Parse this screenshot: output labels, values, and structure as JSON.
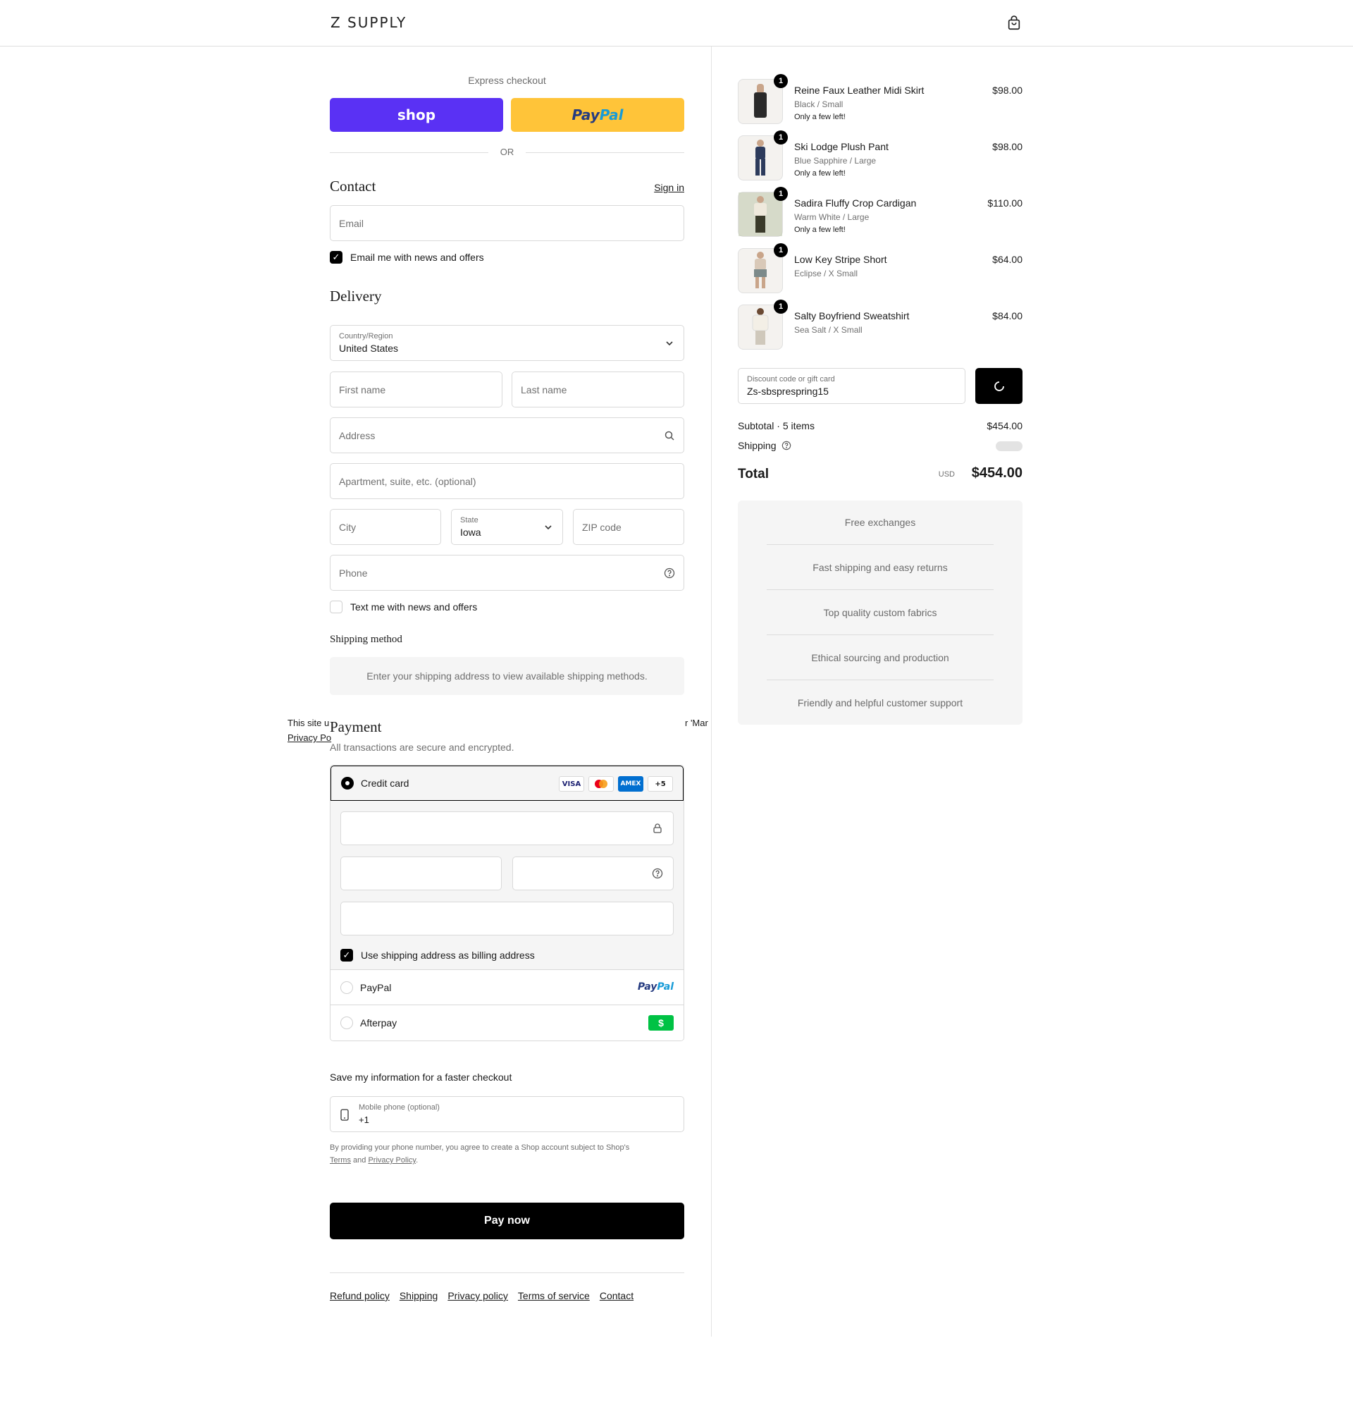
{
  "header": {
    "brand": "Z SUPPLY",
    "cart_icon": "shopping-bag-icon"
  },
  "express": {
    "label": "Express checkout",
    "shop_label": "shop",
    "paypal_part1": "Pay",
    "paypal_part2": "Pal",
    "or_label": "OR"
  },
  "contact": {
    "title": "Contact",
    "sign_in": "Sign in",
    "email_placeholder": "Email",
    "news_checkbox": "Email me with news and offers"
  },
  "delivery": {
    "title": "Delivery",
    "country_label": "Country/Region",
    "country_value": "United States",
    "first_name": "First name",
    "last_name": "Last name",
    "address": "Address",
    "apartment": "Apartment, suite, etc. (optional)",
    "city": "City",
    "state_label": "State",
    "state_value": "Iowa",
    "zip": "ZIP code",
    "phone": "Phone",
    "text_checkbox": "Text me with news and offers"
  },
  "shipping_method": {
    "title": "Shipping method",
    "message": "Enter your shipping address to view available shipping methods."
  },
  "payment": {
    "title": "Payment",
    "subtitle": "All transactions are secure and encrypted.",
    "credit_card_label": "Credit card",
    "badges": [
      "VISA",
      "",
      "AMEX",
      "+5"
    ],
    "billing_checkbox": "Use shipping address as billing address",
    "paypal_label": "PayPal",
    "afterpay_label": "Afterpay",
    "afterpay_glyph": "$"
  },
  "save_info": {
    "title": "Save my information for a faster checkout",
    "mobile_label": "Mobile phone (optional)",
    "mobile_value": "+1",
    "disclaimer_1": "By providing your phone number, you agree to create a Shop account subject to Shop's",
    "terms": "Terms",
    "and": "and",
    "privacy": "Privacy Policy",
    "period": "."
  },
  "pay_now": "Pay now",
  "footer": [
    "Refund policy",
    "Shipping",
    "Privacy policy",
    "Terms of service",
    "Contact"
  ],
  "cookie_fragments": {
    "left": "This site u",
    "left2": "Privacy Po",
    "right": "r 'Mar"
  },
  "order": {
    "items": [
      {
        "qty": "1",
        "name": "Reine Faux Leather Midi Skirt",
        "variant": "Black / Small",
        "note": "Only a few left!",
        "price": "$98.00",
        "thumb_color": "#2a2a2a"
      },
      {
        "qty": "1",
        "name": "Ski Lodge Plush Pant",
        "variant": "Blue Sapphire / Large",
        "note": "Only a few left!",
        "price": "$98.00",
        "thumb_color": "#2d3b5c"
      },
      {
        "qty": "1",
        "name": "Sadira Fluffy Crop Cardigan",
        "variant": "Warm White / Large",
        "note": "Only a few left!",
        "price": "$110.00",
        "thumb_color": "#6e7a57"
      },
      {
        "qty": "1",
        "name": "Low Key Stripe Short",
        "variant": "Eclipse / X Small",
        "note": "",
        "price": "$64.00",
        "thumb_color": "#7c8a8a"
      },
      {
        "qty": "1",
        "name": "Salty Boyfriend Sweatshirt",
        "variant": "Sea Salt / X Small",
        "note": "",
        "price": "$84.00",
        "thumb_color": "#e8e4dc"
      }
    ],
    "discount_label": "Discount code or gift card",
    "discount_value": "Zs-sbsprespring15",
    "subtotal_label": "Subtotal · 5 items",
    "subtotal_value": "$454.00",
    "shipping_label": "Shipping",
    "total_label": "Total",
    "currency": "USD",
    "total_value": "$454.00"
  },
  "perks": [
    "Free exchanges",
    "Fast shipping and easy returns",
    "Top quality custom fabrics",
    "Ethical sourcing and production",
    "Friendly and helpful customer support"
  ],
  "colors": {
    "shop": "#5a31f4",
    "paypal": "#ffc439",
    "afterpay": "#00c244"
  }
}
